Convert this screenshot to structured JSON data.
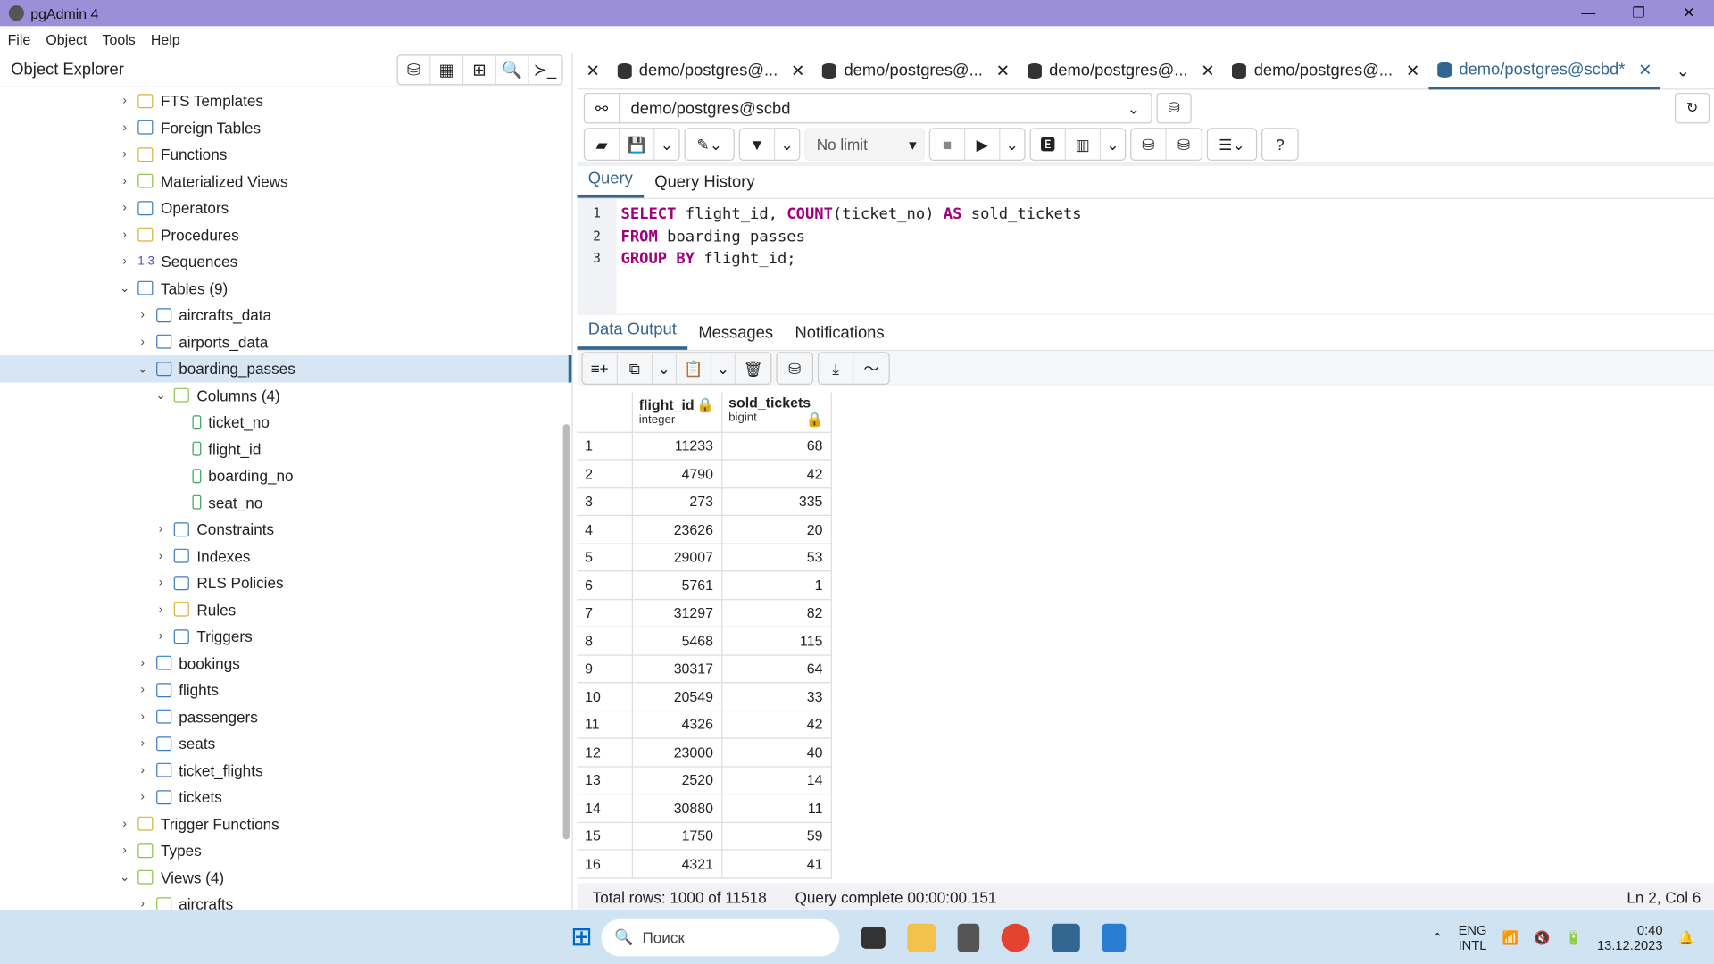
{
  "window": {
    "title": "pgAdmin 4",
    "controls": [
      "—",
      "❐",
      "✕"
    ]
  },
  "menu": [
    "File",
    "Object",
    "Tools",
    "Help"
  ],
  "object_explorer": {
    "title": "Object Explorer",
    "tools": [
      "⛁",
      "▦",
      "⊞",
      "🔍",
      "≻_"
    ],
    "tree": [
      {
        "label": "FTS Templates",
        "level": 0,
        "state": "closed",
        "icon": "fts-template-icon"
      },
      {
        "label": "Foreign Tables",
        "level": 0,
        "state": "closed",
        "icon": "foreign-table-icon"
      },
      {
        "label": "Functions",
        "level": 0,
        "state": "closed",
        "icon": "function-icon"
      },
      {
        "label": "Materialized Views",
        "level": 0,
        "state": "closed",
        "icon": "mview-icon"
      },
      {
        "label": "Operators",
        "level": 0,
        "state": "closed",
        "icon": "operator-icon"
      },
      {
        "label": "Procedures",
        "level": 0,
        "state": "closed",
        "icon": "procedure-icon"
      },
      {
        "label": "Sequences",
        "level": 0,
        "state": "closed",
        "icon": "sequence-icon",
        "prefix": "1.3"
      },
      {
        "label": "Tables (9)",
        "level": 0,
        "state": "open",
        "icon": "table-icon"
      },
      {
        "label": "aircrafts_data",
        "level": 1,
        "state": "closed",
        "icon": "table-icon"
      },
      {
        "label": "airports_data",
        "level": 1,
        "state": "closed",
        "icon": "table-icon"
      },
      {
        "label": "boarding_passes",
        "level": 1,
        "state": "open",
        "icon": "table-icon",
        "selected": true
      },
      {
        "label": "Columns (4)",
        "level": 2,
        "state": "open",
        "icon": "columns-icon"
      },
      {
        "label": "ticket_no",
        "level": 3,
        "state": "leaf",
        "icon": "column-icon"
      },
      {
        "label": "flight_id",
        "level": 3,
        "state": "leaf",
        "icon": "column-icon"
      },
      {
        "label": "boarding_no",
        "level": 3,
        "state": "leaf",
        "icon": "column-icon"
      },
      {
        "label": "seat_no",
        "level": 3,
        "state": "leaf",
        "icon": "column-icon"
      },
      {
        "label": "Constraints",
        "level": 2,
        "state": "closed",
        "icon": "constraint-icon"
      },
      {
        "label": "Indexes",
        "level": 2,
        "state": "closed",
        "icon": "index-icon"
      },
      {
        "label": "RLS Policies",
        "level": 2,
        "state": "closed",
        "icon": "rls-policy-icon"
      },
      {
        "label": "Rules",
        "level": 2,
        "state": "closed",
        "icon": "rule-icon"
      },
      {
        "label": "Triggers",
        "level": 2,
        "state": "closed",
        "icon": "trigger-icon"
      },
      {
        "label": "bookings",
        "level": 1,
        "state": "closed",
        "icon": "table-icon"
      },
      {
        "label": "flights",
        "level": 1,
        "state": "closed",
        "icon": "table-icon"
      },
      {
        "label": "passengers",
        "level": 1,
        "state": "closed",
        "icon": "table-icon"
      },
      {
        "label": "seats",
        "level": 1,
        "state": "closed",
        "icon": "table-icon"
      },
      {
        "label": "ticket_flights",
        "level": 1,
        "state": "closed",
        "icon": "table-icon"
      },
      {
        "label": "tickets",
        "level": 1,
        "state": "closed",
        "icon": "table-icon"
      },
      {
        "label": "Trigger Functions",
        "level": 0,
        "state": "closed",
        "icon": "trigger-function-icon"
      },
      {
        "label": "Types",
        "level": 0,
        "state": "closed",
        "icon": "type-icon"
      },
      {
        "label": "Views (4)",
        "level": 0,
        "state": "open",
        "icon": "view-icon"
      },
      {
        "label": "aircrafts",
        "level": 1,
        "state": "closed",
        "icon": "view-icon"
      }
    ]
  },
  "tabs": [
    {
      "label": "demo/postgres@..."
    },
    {
      "label": "demo/postgres@..."
    },
    {
      "label": "demo/postgres@..."
    },
    {
      "label": "demo/postgres@..."
    },
    {
      "label": "demo/postgres@scbd*",
      "active": true
    }
  ],
  "connection": "demo/postgres@scbd",
  "limit": "No limit",
  "query_tabs": [
    "Query",
    "Query History"
  ],
  "code": [
    [
      [
        "kw",
        "SELECT"
      ],
      [
        "t",
        " flight_id, "
      ],
      [
        "kw",
        "COUNT"
      ],
      [
        "t",
        "(ticket_no) "
      ],
      [
        "kw",
        "AS"
      ],
      [
        "t",
        " sold_tickets"
      ]
    ],
    [
      [
        "kw",
        "FROM"
      ],
      [
        "t",
        " boarding_passes"
      ]
    ],
    [
      [
        "kw",
        "GROUP BY"
      ],
      [
        "t",
        " flight_id;"
      ]
    ]
  ],
  "result_tabs": [
    "Data Output",
    "Messages",
    "Notifications"
  ],
  "grid": {
    "columns": [
      {
        "name": "flight_id",
        "type": "integer"
      },
      {
        "name": "sold_tickets",
        "type": "bigint"
      }
    ],
    "rows": [
      [
        1,
        11233,
        68
      ],
      [
        2,
        4790,
        42
      ],
      [
        3,
        273,
        335
      ],
      [
        4,
        23626,
        20
      ],
      [
        5,
        29007,
        53
      ],
      [
        6,
        5761,
        1
      ],
      [
        7,
        31297,
        82
      ],
      [
        8,
        5468,
        115
      ],
      [
        9,
        30317,
        64
      ],
      [
        10,
        20549,
        33
      ],
      [
        11,
        4326,
        42
      ],
      [
        12,
        23000,
        40
      ],
      [
        13,
        2520,
        14
      ],
      [
        14,
        30880,
        11
      ],
      [
        15,
        1750,
        59
      ],
      [
        16,
        4321,
        41
      ]
    ]
  },
  "status": {
    "rows": "Total rows: 1000 of 11518",
    "query": "Query complete 00:00:00.151",
    "cursor": "Ln 2, Col 6"
  },
  "taskbar": {
    "search": "Поиск",
    "lang1": "ENG",
    "lang2": "INTL",
    "time": "0:40",
    "date": "13.12.2023"
  }
}
